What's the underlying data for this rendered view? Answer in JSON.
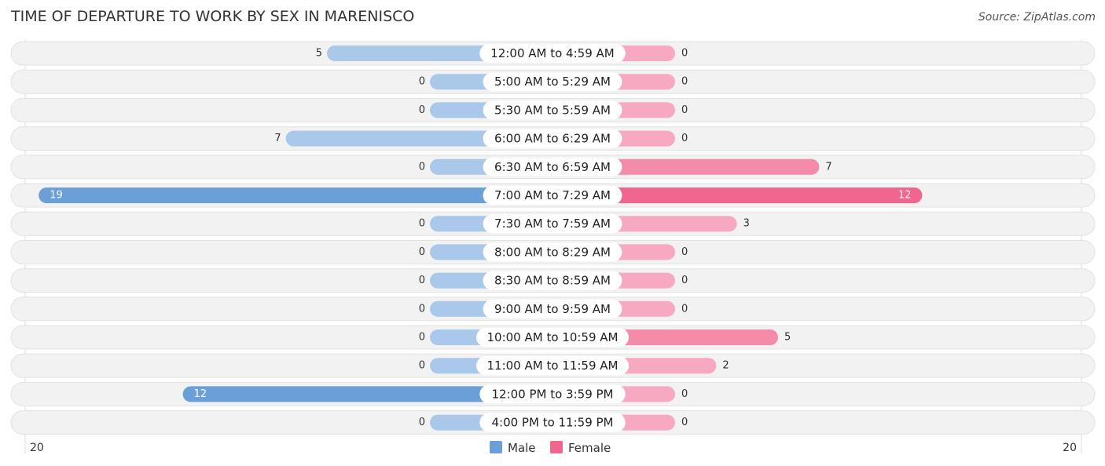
{
  "header": {
    "title": "TIME OF DEPARTURE TO WORK BY SEX IN MARENISCO",
    "source": "Source: ZipAtlas.com"
  },
  "colors": {
    "male": "#6a9fd8",
    "male_light": "#a9c8ea",
    "female": "#f0668f",
    "female_light": "#f6a9c0",
    "track": "#f2f2f2"
  },
  "chart_data": {
    "type": "bar",
    "orientation": "horizontal-diverging",
    "title": "TIME OF DEPARTURE TO WORK BY SEX IN MARENISCO",
    "categories": [
      "12:00 AM to 4:59 AM",
      "5:00 AM to 5:29 AM",
      "5:30 AM to 5:59 AM",
      "6:00 AM to 6:29 AM",
      "6:30 AM to 6:59 AM",
      "7:00 AM to 7:29 AM",
      "7:30 AM to 7:59 AM",
      "8:00 AM to 8:29 AM",
      "8:30 AM to 8:59 AM",
      "9:00 AM to 9:59 AM",
      "10:00 AM to 10:59 AM",
      "11:00 AM to 11:59 AM",
      "12:00 PM to 3:59 PM",
      "4:00 PM to 11:59 PM"
    ],
    "series": [
      {
        "name": "Male",
        "values": [
          5,
          0,
          0,
          7,
          0,
          19,
          0,
          0,
          0,
          0,
          0,
          0,
          12,
          0
        ]
      },
      {
        "name": "Female",
        "values": [
          0,
          0,
          0,
          0,
          7,
          12,
          3,
          0,
          0,
          0,
          5,
          2,
          0,
          0
        ]
      }
    ],
    "axis": {
      "left_label": "20",
      "right_label": "20",
      "max": 20
    },
    "legend": {
      "position": "bottom-center",
      "items": [
        "Male",
        "Female"
      ]
    },
    "grid": false
  }
}
